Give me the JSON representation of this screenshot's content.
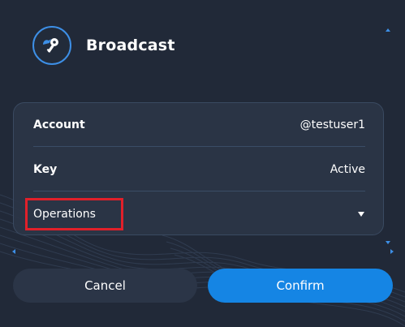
{
  "header": {
    "title": "Broadcast",
    "logo_icon": "key-icon"
  },
  "details": {
    "account_label": "Account",
    "account_value": "@testuser1",
    "key_label": "Key",
    "key_value": "Active",
    "operations_label": "Operations",
    "operations_expand_icon": "caret-down-icon"
  },
  "actions": {
    "cancel_label": "Cancel",
    "confirm_label": "Confirm"
  },
  "colors": {
    "background": "#212938",
    "card": "#2b3547",
    "accent": "#1585e4",
    "highlight": "#e0202a"
  }
}
